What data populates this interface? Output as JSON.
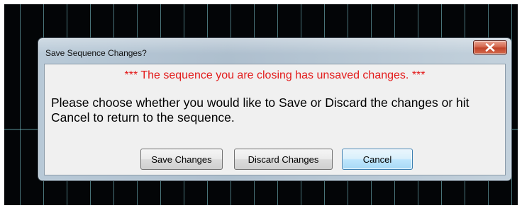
{
  "dialog": {
    "title": "Save Sequence Changes?",
    "close_icon": "close-icon",
    "warning": "*** The sequence you are closing has unsaved changes. ***",
    "message": "Please choose whether you would like to Save or Discard the changes or hit Cancel to return to the sequence.",
    "buttons": {
      "save": "Save Changes",
      "discard": "Discard Changes",
      "cancel": "Cancel"
    }
  },
  "colors": {
    "warning_text": "#e31b1b",
    "close_button": "#c1442a",
    "default_button_border": "#3c7fb1",
    "background_grid": "#82cdd7"
  }
}
